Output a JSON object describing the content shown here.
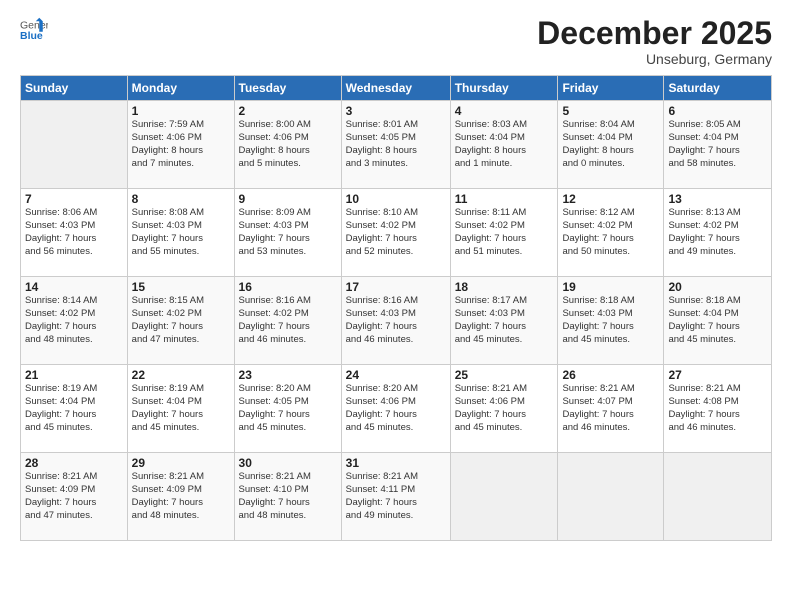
{
  "header": {
    "logo": {
      "general": "General",
      "blue": "Blue"
    },
    "title": "December 2025",
    "subtitle": "Unseburg, Germany"
  },
  "days_of_week": [
    "Sunday",
    "Monday",
    "Tuesday",
    "Wednesday",
    "Thursday",
    "Friday",
    "Saturday"
  ],
  "weeks": [
    [
      {
        "day": "",
        "info": ""
      },
      {
        "day": "1",
        "info": "Sunrise: 7:59 AM\nSunset: 4:06 PM\nDaylight: 8 hours\nand 7 minutes."
      },
      {
        "day": "2",
        "info": "Sunrise: 8:00 AM\nSunset: 4:06 PM\nDaylight: 8 hours\nand 5 minutes."
      },
      {
        "day": "3",
        "info": "Sunrise: 8:01 AM\nSunset: 4:05 PM\nDaylight: 8 hours\nand 3 minutes."
      },
      {
        "day": "4",
        "info": "Sunrise: 8:03 AM\nSunset: 4:04 PM\nDaylight: 8 hours\nand 1 minute."
      },
      {
        "day": "5",
        "info": "Sunrise: 8:04 AM\nSunset: 4:04 PM\nDaylight: 8 hours\nand 0 minutes."
      },
      {
        "day": "6",
        "info": "Sunrise: 8:05 AM\nSunset: 4:04 PM\nDaylight: 7 hours\nand 58 minutes."
      }
    ],
    [
      {
        "day": "7",
        "info": "Sunrise: 8:06 AM\nSunset: 4:03 PM\nDaylight: 7 hours\nand 56 minutes."
      },
      {
        "day": "8",
        "info": "Sunrise: 8:08 AM\nSunset: 4:03 PM\nDaylight: 7 hours\nand 55 minutes."
      },
      {
        "day": "9",
        "info": "Sunrise: 8:09 AM\nSunset: 4:03 PM\nDaylight: 7 hours\nand 53 minutes."
      },
      {
        "day": "10",
        "info": "Sunrise: 8:10 AM\nSunset: 4:02 PM\nDaylight: 7 hours\nand 52 minutes."
      },
      {
        "day": "11",
        "info": "Sunrise: 8:11 AM\nSunset: 4:02 PM\nDaylight: 7 hours\nand 51 minutes."
      },
      {
        "day": "12",
        "info": "Sunrise: 8:12 AM\nSunset: 4:02 PM\nDaylight: 7 hours\nand 50 minutes."
      },
      {
        "day": "13",
        "info": "Sunrise: 8:13 AM\nSunset: 4:02 PM\nDaylight: 7 hours\nand 49 minutes."
      }
    ],
    [
      {
        "day": "14",
        "info": "Sunrise: 8:14 AM\nSunset: 4:02 PM\nDaylight: 7 hours\nand 48 minutes."
      },
      {
        "day": "15",
        "info": "Sunrise: 8:15 AM\nSunset: 4:02 PM\nDaylight: 7 hours\nand 47 minutes."
      },
      {
        "day": "16",
        "info": "Sunrise: 8:16 AM\nSunset: 4:02 PM\nDaylight: 7 hours\nand 46 minutes."
      },
      {
        "day": "17",
        "info": "Sunrise: 8:16 AM\nSunset: 4:03 PM\nDaylight: 7 hours\nand 46 minutes."
      },
      {
        "day": "18",
        "info": "Sunrise: 8:17 AM\nSunset: 4:03 PM\nDaylight: 7 hours\nand 45 minutes."
      },
      {
        "day": "19",
        "info": "Sunrise: 8:18 AM\nSunset: 4:03 PM\nDaylight: 7 hours\nand 45 minutes."
      },
      {
        "day": "20",
        "info": "Sunrise: 8:18 AM\nSunset: 4:04 PM\nDaylight: 7 hours\nand 45 minutes."
      }
    ],
    [
      {
        "day": "21",
        "info": "Sunrise: 8:19 AM\nSunset: 4:04 PM\nDaylight: 7 hours\nand 45 minutes."
      },
      {
        "day": "22",
        "info": "Sunrise: 8:19 AM\nSunset: 4:04 PM\nDaylight: 7 hours\nand 45 minutes."
      },
      {
        "day": "23",
        "info": "Sunrise: 8:20 AM\nSunset: 4:05 PM\nDaylight: 7 hours\nand 45 minutes."
      },
      {
        "day": "24",
        "info": "Sunrise: 8:20 AM\nSunset: 4:06 PM\nDaylight: 7 hours\nand 45 minutes."
      },
      {
        "day": "25",
        "info": "Sunrise: 8:21 AM\nSunset: 4:06 PM\nDaylight: 7 hours\nand 45 minutes."
      },
      {
        "day": "26",
        "info": "Sunrise: 8:21 AM\nSunset: 4:07 PM\nDaylight: 7 hours\nand 46 minutes."
      },
      {
        "day": "27",
        "info": "Sunrise: 8:21 AM\nSunset: 4:08 PM\nDaylight: 7 hours\nand 46 minutes."
      }
    ],
    [
      {
        "day": "28",
        "info": "Sunrise: 8:21 AM\nSunset: 4:09 PM\nDaylight: 7 hours\nand 47 minutes."
      },
      {
        "day": "29",
        "info": "Sunrise: 8:21 AM\nSunset: 4:09 PM\nDaylight: 7 hours\nand 48 minutes."
      },
      {
        "day": "30",
        "info": "Sunrise: 8:21 AM\nSunset: 4:10 PM\nDaylight: 7 hours\nand 48 minutes."
      },
      {
        "day": "31",
        "info": "Sunrise: 8:21 AM\nSunset: 4:11 PM\nDaylight: 7 hours\nand 49 minutes."
      },
      {
        "day": "",
        "info": ""
      },
      {
        "day": "",
        "info": ""
      },
      {
        "day": "",
        "info": ""
      }
    ]
  ]
}
